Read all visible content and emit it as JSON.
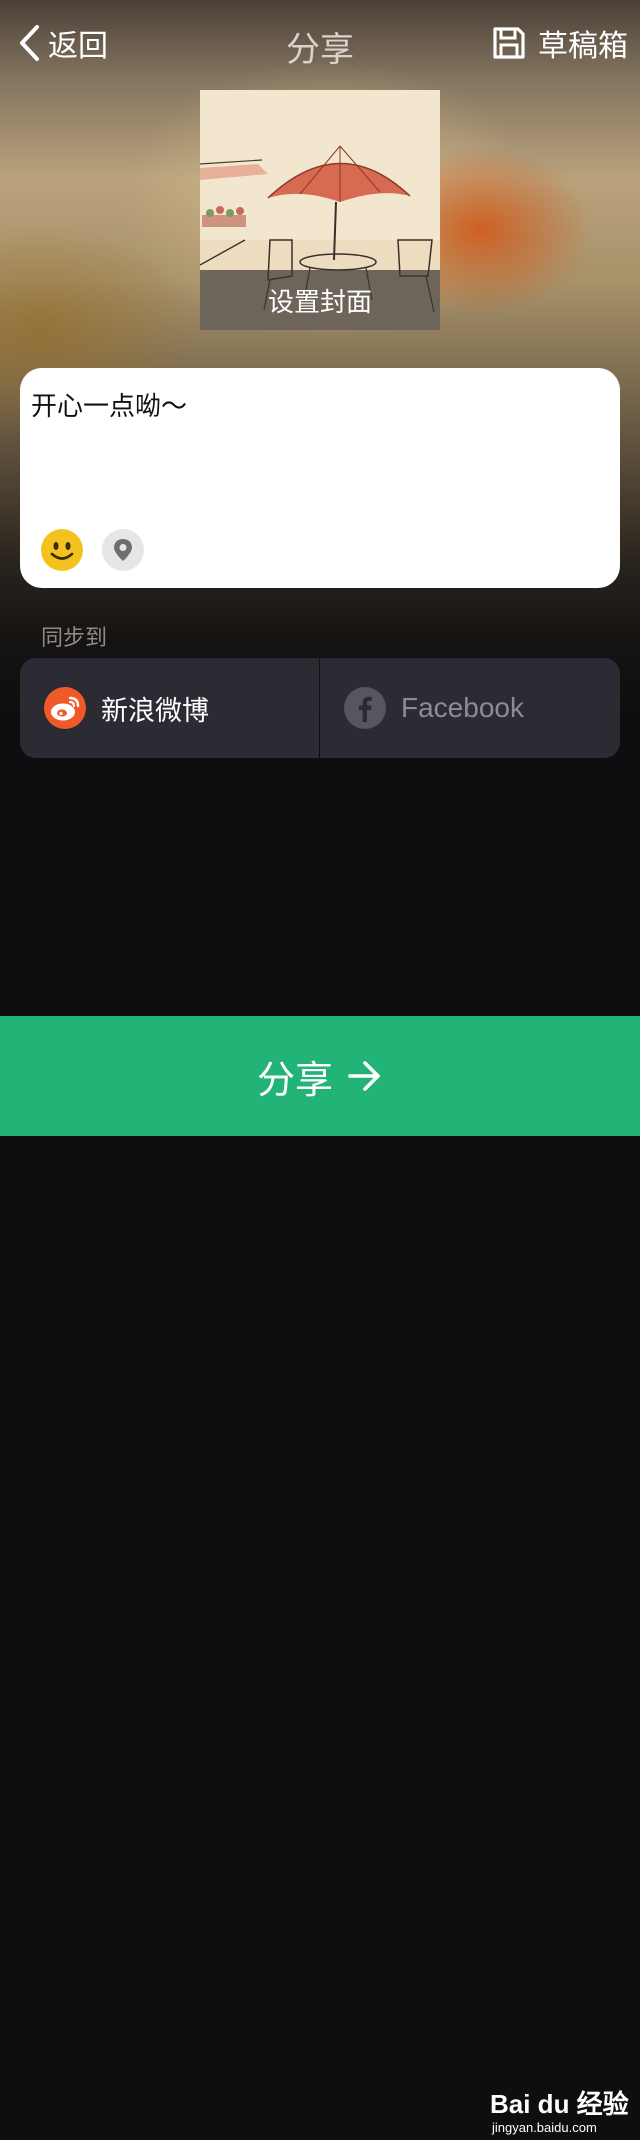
{
  "header": {
    "back_label": "返回",
    "title": "分享",
    "drafts_label": "草稿箱"
  },
  "cover": {
    "label": "设置封面"
  },
  "compose": {
    "text": "开心一点呦～"
  },
  "sync": {
    "label": "同步到",
    "items": [
      {
        "name": "新浪微博",
        "icon": "weibo-icon",
        "enabled": true
      },
      {
        "name": "Facebook",
        "icon": "facebook-icon",
        "enabled": false
      }
    ]
  },
  "share_button": {
    "label": "分享"
  },
  "watermark": {
    "brand": "Bai du 经验",
    "url": "jingyan.baidu.com"
  },
  "colors": {
    "share_green": "#22b477",
    "weibo_orange": "#f05a28",
    "emoji_yellow": "#f4c21f",
    "sync_bg": "#2c2b33"
  }
}
